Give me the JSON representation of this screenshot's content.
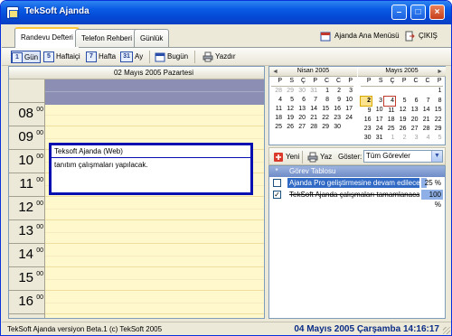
{
  "window": {
    "title": "TekSoft Ajanda"
  },
  "tabs": [
    {
      "label": "Randevu Defteri",
      "active": true
    },
    {
      "label": "Telefon Rehberi",
      "active": false
    },
    {
      "label": "Günlük",
      "active": false
    }
  ],
  "header": {
    "menu_label": "Ajanda Ana Menüsü",
    "exit_label": "ÇIKIŞ"
  },
  "toolbar": {
    "day": {
      "num": "1",
      "label": "Gün"
    },
    "workweek": {
      "num": "5",
      "label": "Haftaiçi"
    },
    "week": {
      "num": "7",
      "label": "Hafta"
    },
    "month": {
      "num": "31",
      "label": "Ay"
    },
    "today_label": "Bugün",
    "print_label": "Yazdır"
  },
  "day_view": {
    "date_header": "02 Mayıs 2005 Pazartesi",
    "hours": [
      {
        "h": "",
        "m": ""
      },
      {
        "h": "08",
        "m": "00"
      },
      {
        "h": "09",
        "m": "00"
      },
      {
        "h": "10",
        "m": "00"
      },
      {
        "h": "11",
        "m": "00"
      },
      {
        "h": "12",
        "m": "00"
      },
      {
        "h": "13",
        "m": "00"
      },
      {
        "h": "14",
        "m": "00"
      },
      {
        "h": "15",
        "m": "00"
      },
      {
        "h": "16",
        "m": "00"
      }
    ],
    "appointment": {
      "title": "Teksoft Ajanda (Web)",
      "description": "tanıtım çalışmaları yapılacak."
    }
  },
  "calendars": [
    {
      "month": "Nisan 2005",
      "days": [
        "P",
        "S",
        "Ç",
        "P",
        "C",
        "C",
        "P"
      ],
      "weeks": [
        [
          "28",
          "29",
          "30",
          "31",
          "1",
          "2",
          "3"
        ],
        [
          "4",
          "5",
          "6",
          "7",
          "8",
          "9",
          "10"
        ],
        [
          "11",
          "12",
          "13",
          "14",
          "15",
          "16",
          "17"
        ],
        [
          "18",
          "19",
          "20",
          "21",
          "22",
          "23",
          "24"
        ],
        [
          "25",
          "26",
          "27",
          "28",
          "29",
          "30",
          ""
        ]
      ]
    },
    {
      "month": "Mayıs 2005",
      "days": [
        "P",
        "S",
        "Ç",
        "P",
        "C",
        "C",
        "P"
      ],
      "weeks": [
        [
          "",
          "",
          "",
          "",
          "",
          "",
          "1"
        ],
        [
          "2",
          "3",
          "4",
          "5",
          "6",
          "7",
          "8"
        ],
        [
          "9",
          "10",
          "11",
          "12",
          "13",
          "14",
          "15"
        ],
        [
          "16",
          "17",
          "18",
          "19",
          "20",
          "21",
          "22"
        ],
        [
          "23",
          "24",
          "25",
          "26",
          "27",
          "28",
          "29"
        ],
        [
          "30",
          "31",
          "1",
          "2",
          "3",
          "4",
          "5"
        ]
      ]
    }
  ],
  "tasks_toolbar": {
    "new_label": "Yeni",
    "print_label": "Yaz",
    "show_label": "Göster:",
    "filter_value": "Tüm Görevler"
  },
  "tasks": {
    "header": "Görev Tablosu",
    "star": "*",
    "rows": [
      {
        "text": "Ajanda Pro geliştirmesine devam edilecek.",
        "pct": "25 %",
        "progress": 0.25,
        "checked": false
      },
      {
        "text": "TekSoft Ajanda çalışmaları tamamlanacak.",
        "pct": "100 %",
        "progress": 1.0,
        "checked": true
      }
    ]
  },
  "status": {
    "left": "TekSoft Ajanda versiyon Beta.1  (c) TekSoft 2005",
    "right": "04 Mayıs 2005 Çarşamba   14:16:17"
  }
}
